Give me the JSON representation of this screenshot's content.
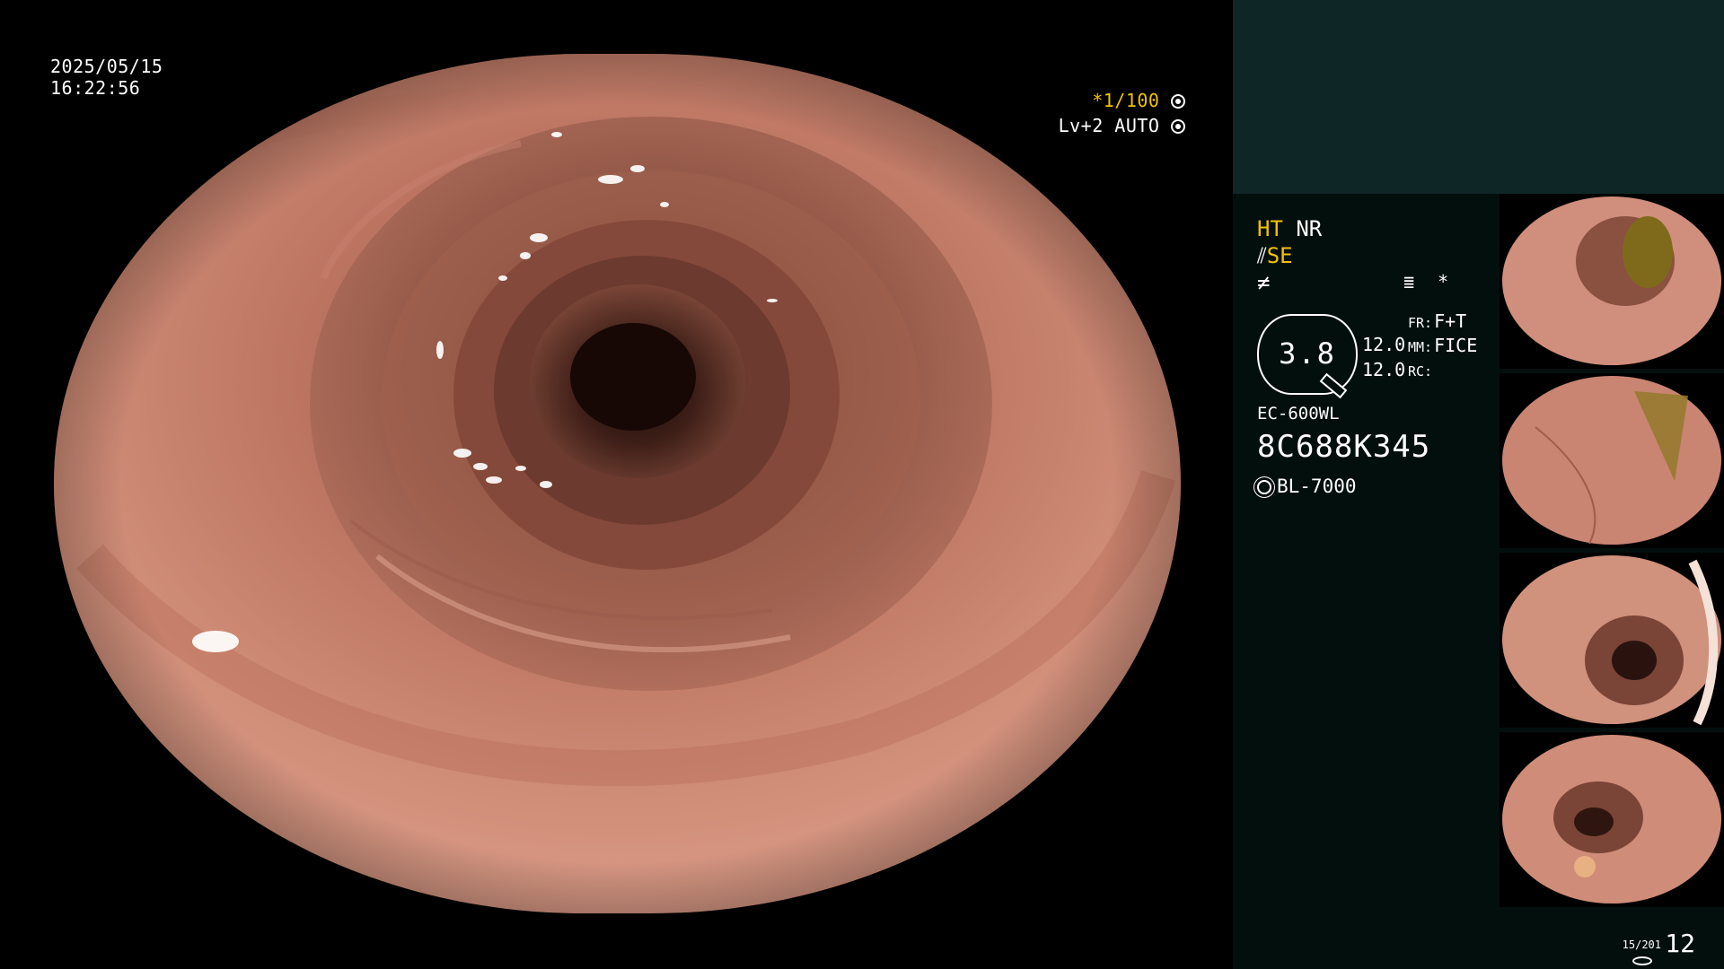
{
  "overlay": {
    "date": "2025/05/15",
    "time": "16:22:56",
    "shutter_speed": "*1/100",
    "iris_mode": "Lv+2 AUTO"
  },
  "panel": {
    "status_line1_left": "HT",
    "status_line1_right": "NR",
    "status_line2": "SE",
    "status_line3": "≠",
    "misc_icon_right": "*",
    "enhancement_value": "3.8",
    "value_a": "12.0",
    "value_b": "12.0",
    "fr_label": "FR:",
    "fr_value": "F+T",
    "mm_label": "MM:",
    "mm_value": "FICE",
    "rc_label": "RC:",
    "scope_model": "EC-600WL",
    "scope_serial": "8C688K345",
    "light_source": "BL-7000",
    "counter_small": "15/201",
    "counter_big": "12"
  },
  "colors": {
    "highlight": "#f2c200",
    "panel_bg": "#030f0d",
    "panel_top_band": "#0e2726",
    "mucosa": "#cf8a76"
  },
  "icons": {
    "shutter_icon": "shutter-ring-icon",
    "iris_icon": "iris-ring-icon",
    "light_icon": "sun-icon",
    "storage_icon": "disc-icon"
  }
}
